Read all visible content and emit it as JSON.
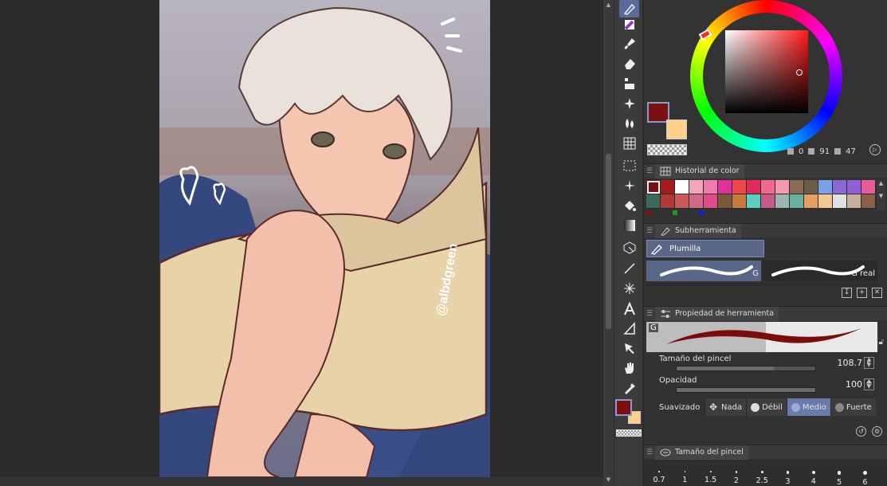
{
  "canvas": {
    "watermark": "@albdgreen"
  },
  "color_wheel": {
    "main_color": "#7c1010",
    "sub_color": "#ffd08a",
    "hue": "0",
    "saturation": "91",
    "value": "47"
  },
  "panels": {
    "color_history": {
      "title": "Historial de color",
      "swatches": [
        [
          "#7c1010",
          "#a51a1a",
          "#ffffff",
          "#f4a6b8",
          "#f07ab0",
          "#e0309a",
          "#f04848",
          "#e02a5a",
          "#f06a90",
          "#f49ab0",
          "#8a6a50",
          "#6a5e48",
          "#7aa0e8",
          "#8a6ad0",
          "#9060d8",
          "#e85a9a"
        ],
        [
          "#3a6a5a",
          "#b03a3a",
          "#c85a5a",
          "#d06a8a",
          "#e04a8a",
          "#7a5a3a",
          "#c87a3a",
          "#5ad0c0",
          "#c85a8a",
          "#9ab8b0",
          "#6ab0a0",
          "#e8a060",
          "#f0c890",
          "#e0e0e0",
          "#c8b0a0",
          "#8a6048"
        ]
      ],
      "marker_colors": [
        "#7c1010",
        "#1a9a1a",
        "#1a1ad0"
      ]
    },
    "subtool": {
      "title": "Subherramienta",
      "selected": "Plumilla",
      "brushes": [
        {
          "label": "G",
          "selected": true
        },
        {
          "label": "G real",
          "selected": false
        }
      ]
    },
    "tool_property": {
      "title": "Propiedad de herramienta",
      "preview_label": "G",
      "brush_size_label": "Tamaño del pincel",
      "brush_size_value": "108.7",
      "brush_size_fill": 0.7,
      "opacity_label": "Opacidad",
      "opacity_value": "100",
      "opacity_fill": 1.0,
      "smoothing_label": "Suavizado",
      "smoothing_options": [
        "Nada",
        "Débil",
        "Medio",
        "Fuerte"
      ],
      "smoothing_selected": "Medio"
    },
    "brush_size": {
      "title": "Tamaño del pincel",
      "sizes": [
        "0.7",
        "1",
        "1.5",
        "2",
        "2.5",
        "3",
        "4",
        "5",
        "6"
      ]
    }
  }
}
